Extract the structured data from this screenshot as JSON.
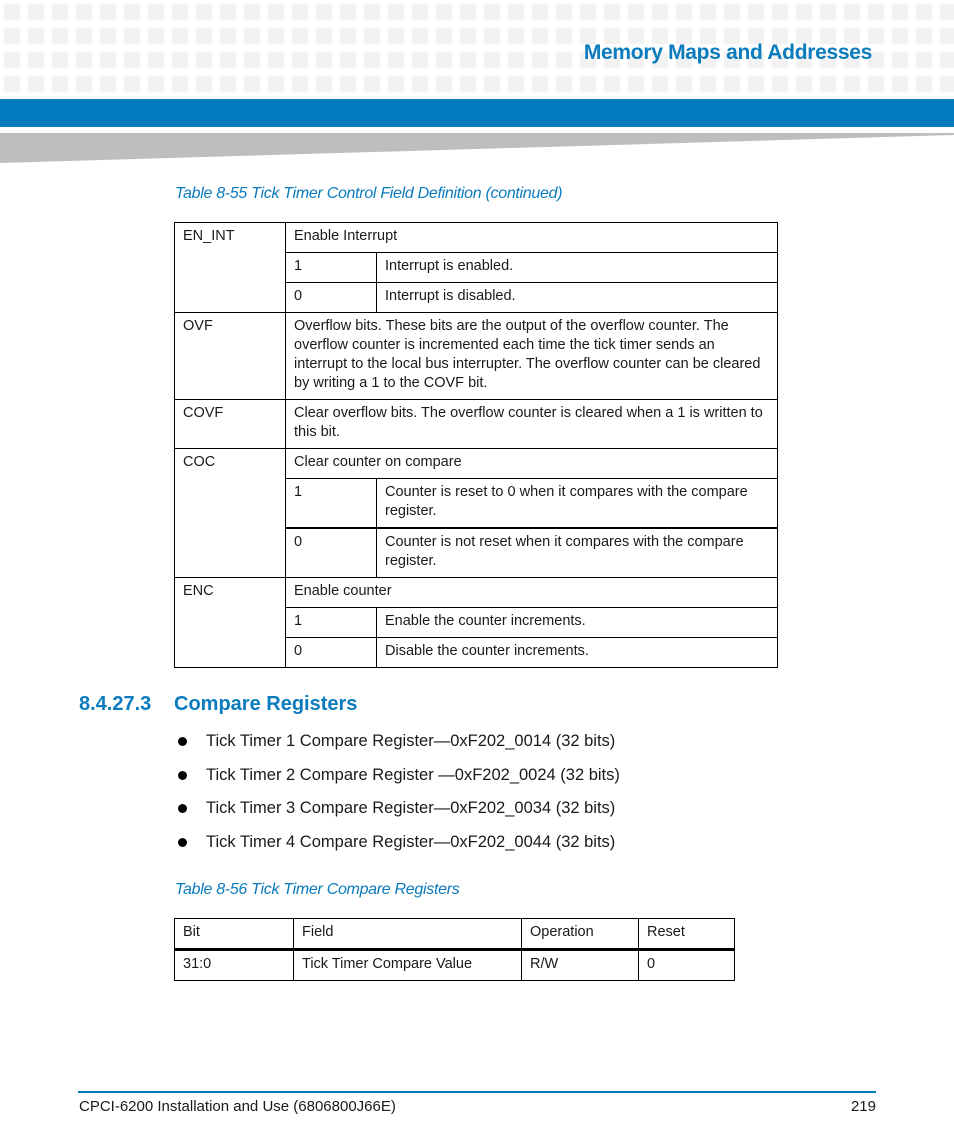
{
  "header": {
    "chapter_title": "Memory Maps and Addresses",
    "accent_color": "#017bbe"
  },
  "table_55": {
    "caption": "Table 8-55 Tick Timer Control Field Definition (continued)",
    "rows": [
      {
        "field": "EN_INT",
        "description": "Enable Interrupt",
        "values": [
          {
            "value": "1",
            "meaning": "Interrupt is enabled."
          },
          {
            "value": "0",
            "meaning": "Interrupt is disabled."
          }
        ]
      },
      {
        "field": "OVF",
        "description": "Overflow bits.  These bits are the output of the overflow counter.  The overflow counter is incremented each time the tick timer sends an interrupt to the local bus interrupter.  The overflow counter can be cleared by writing a 1 to the COVF bit."
      },
      {
        "field": "COVF",
        "description": "Clear overflow bits.  The overflow counter is cleared when a 1 is written to this bit."
      },
      {
        "field": "COC",
        "description": "Clear counter on compare",
        "values": [
          {
            "value": "1",
            "meaning": "Counter is reset to 0 when it compares with the compare register."
          },
          {
            "value": "0",
            "meaning": "Counter is not reset when it compares with the compare register."
          }
        ]
      },
      {
        "field": "ENC",
        "description": "Enable counter",
        "values": [
          {
            "value": "1",
            "meaning": "Enable the counter increments."
          },
          {
            "value": "0",
            "meaning": "Disable the counter increments."
          }
        ]
      }
    ]
  },
  "section": {
    "number": "8.4.27.3",
    "title": "Compare Registers",
    "bullets": [
      "Tick Timer 1 Compare Register—0xF202_0014 (32 bits)",
      "Tick Timer 2 Compare Register —0xF202_0024 (32 bits)",
      "Tick Timer 3 Compare Register—0xF202_0034 (32 bits)",
      "Tick Timer 4 Compare Register—0xF202_0044 (32 bits)"
    ]
  },
  "table_56": {
    "caption": "Table 8-56 Tick Timer Compare Registers",
    "headers": [
      "Bit",
      "Field",
      "Operation",
      "Reset"
    ],
    "rows": [
      [
        "31:0",
        "Tick Timer Compare Value",
        "R/W",
        "0"
      ]
    ]
  },
  "footer": {
    "document": "CPCI-6200 Installation and Use (6806800J66E)",
    "page_number": "219"
  }
}
